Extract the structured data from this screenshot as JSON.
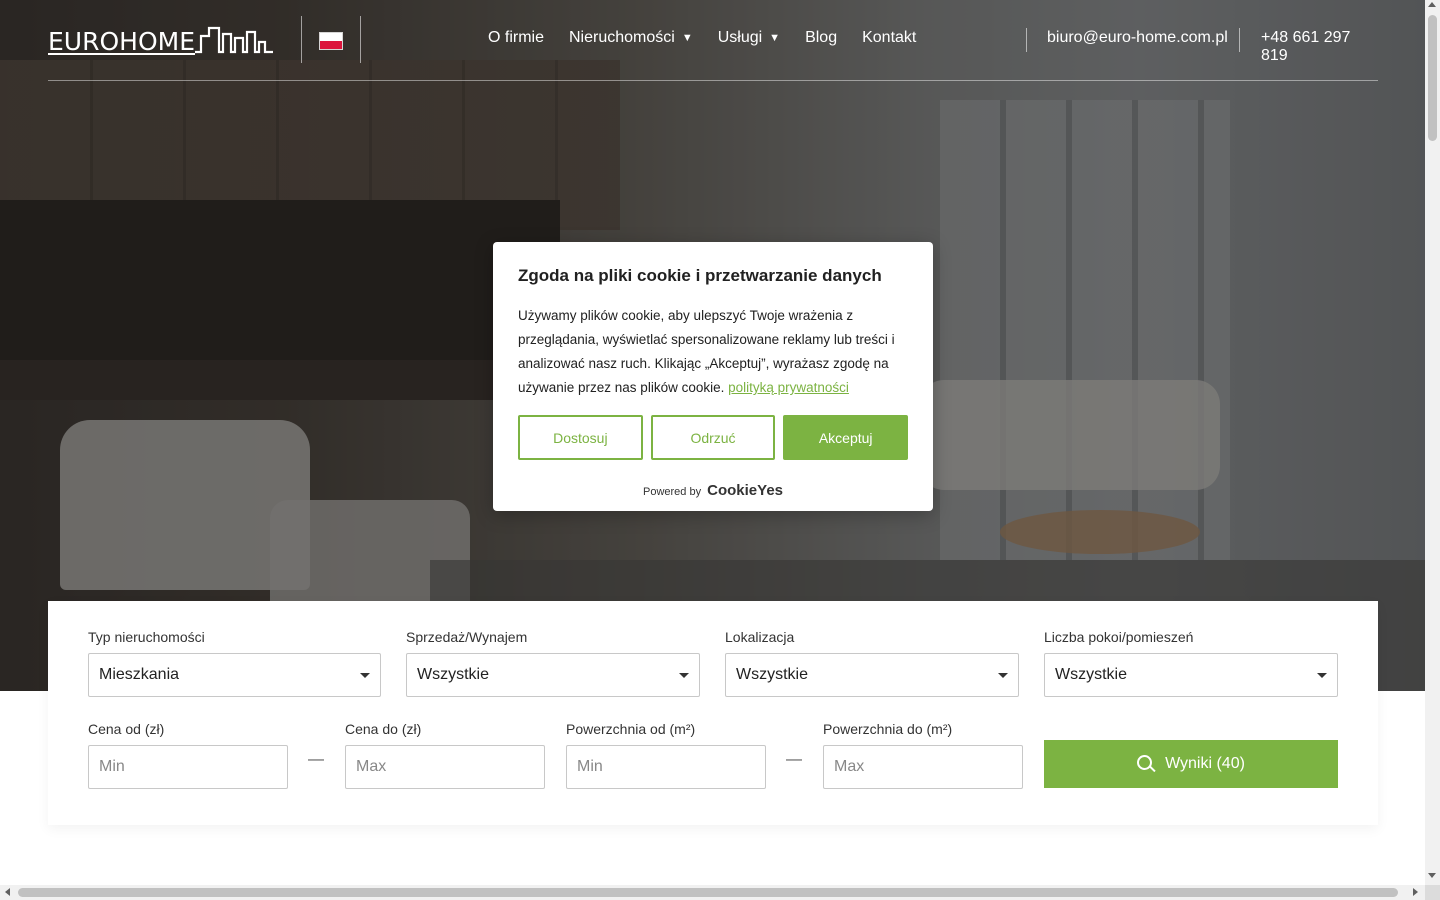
{
  "header": {
    "logo_text": "EUROHOME",
    "language_flag": "poland-flag-icon",
    "nav": [
      {
        "label": "O firmie",
        "has_dropdown": false
      },
      {
        "label": "Nieruchomości",
        "has_dropdown": true
      },
      {
        "label": "Usługi",
        "has_dropdown": true
      },
      {
        "label": "Blog",
        "has_dropdown": false
      },
      {
        "label": "Kontakt",
        "has_dropdown": false
      }
    ],
    "dropdown_caret": "▼",
    "email": "biuro@euro-home.com.pl",
    "phone": "+48 661 297 819"
  },
  "cookie": {
    "title": "Zgoda na pliki cookie i przetwarzanie danych",
    "body": "Używamy plików cookie, aby ulepszyć Twoje wrażenia z przeglądania, wyświetlać spersonalizowane reklamy lub treści i analizować nasz ruch. Klikając „Akceptuj”, wyrażasz zgodę na używanie przez nas plików cookie.",
    "policy_link": "polityką prywatności",
    "buttons": {
      "customize": "Dostosuj",
      "reject": "Odrzuć",
      "accept": "Akceptuj"
    },
    "powered_by": "Powered by",
    "brand": "CookieYes"
  },
  "search": {
    "property_type": {
      "label": "Typ nieruchomości",
      "value": "Mieszkania"
    },
    "transaction": {
      "label": "Sprzedaż/Wynajem",
      "value": "Wszystkie"
    },
    "location": {
      "label": "Lokalizacja",
      "value": "Wszystkie"
    },
    "rooms": {
      "label": "Liczba pokoi/pomieszeń",
      "value": "Wszystkie"
    },
    "price_from": {
      "label": "Cena od (zł)",
      "placeholder": "Min"
    },
    "price_to": {
      "label": "Cena do (zł)",
      "placeholder": "Max"
    },
    "area_from": {
      "label": "Powerzchnia od (m²)",
      "placeholder": "Min"
    },
    "area_to": {
      "label": "Powerzchnia do (m²)",
      "placeholder": "Max"
    },
    "range_separator": "—",
    "results_button": "Wyniki (40)"
  },
  "colors": {
    "accent": "#7cb342",
    "overlay": "rgba(20,20,20,0.45)",
    "text": "#212121"
  }
}
